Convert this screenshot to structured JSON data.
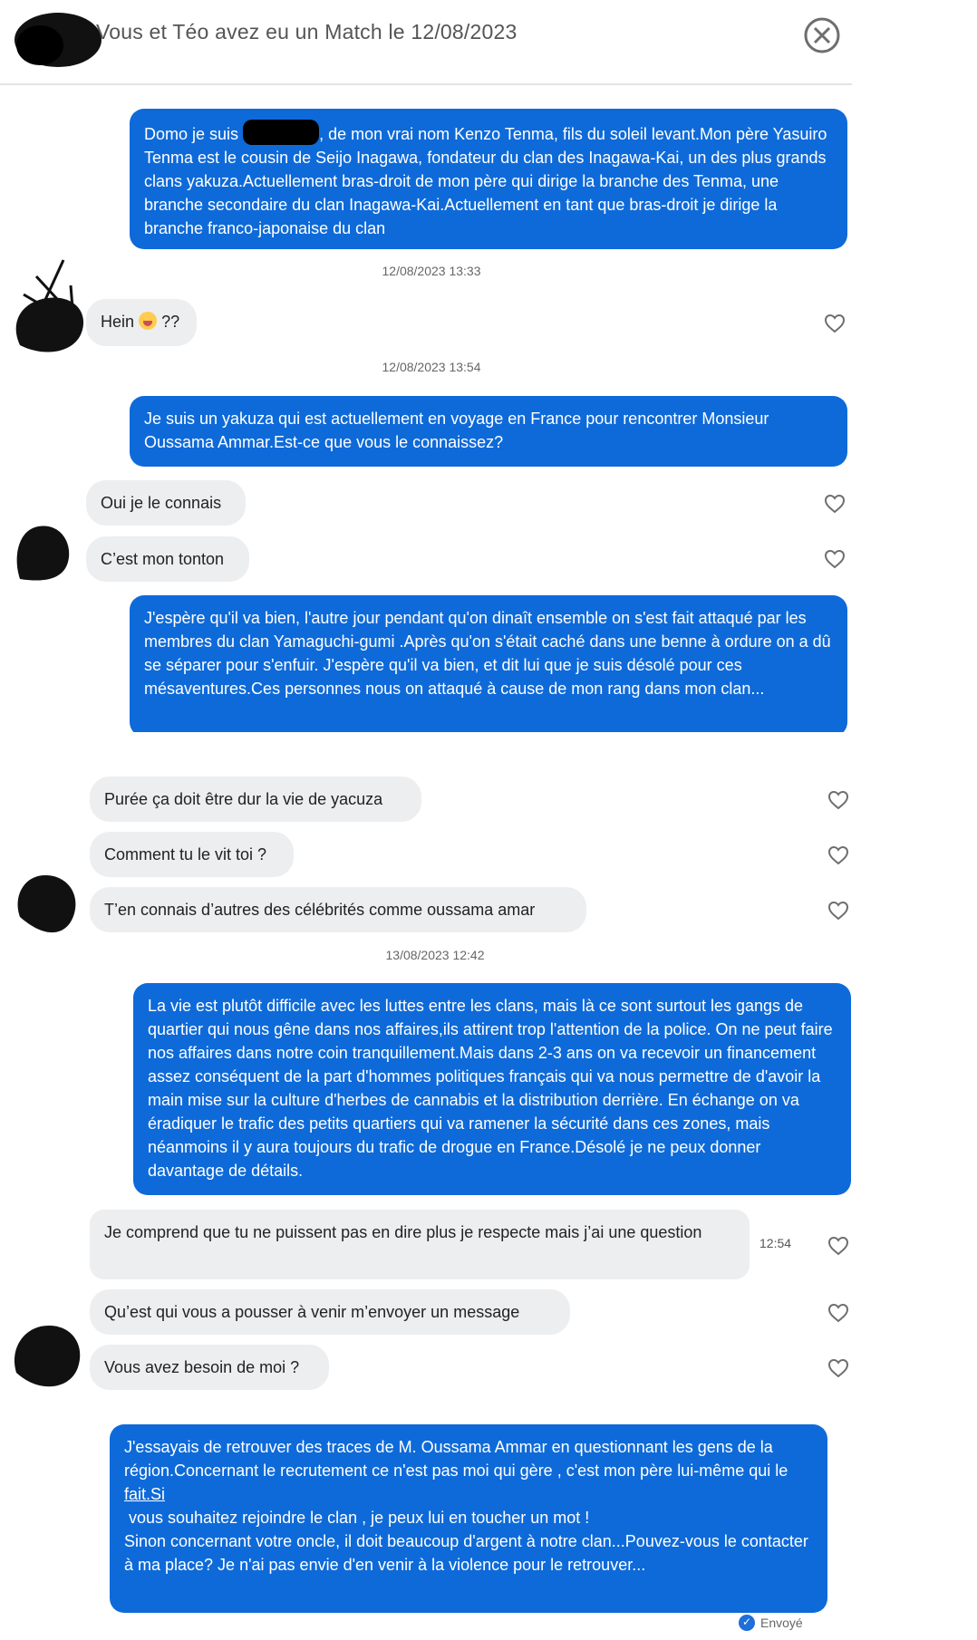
{
  "header": {
    "title": "Vous et Téo avez eu un Match le 12/08/2023",
    "close_icon": "close-circle-icon"
  },
  "messages": [
    {
      "type": "sent",
      "text_pre": "Domo je suis",
      "text_post": ", de mon vrai nom Kenzo Tenma, fils du soleil levant.Mon père Yasuiro Tenma est le cousin de Seijo Inagawa, fondateur du clan des Inagawa-Kai, un des plus grands clans yakuza.Actuellement bras-droit de mon père qui dirige la branche des Tenma, une branche secondaire du clan Inagawa-Kai.Actuellement en tant que bras-droit je dirige la branche franco-japonaise du clan"
    },
    {
      "type": "timestamp",
      "text": "12/08/2023 13:33"
    },
    {
      "type": "recv",
      "text_pre": "Hein",
      "text_post": "??"
    },
    {
      "type": "timestamp",
      "text": "12/08/2023 13:54"
    },
    {
      "type": "sent",
      "text": "Je suis un yakuza qui est actuellement en voyage en France pour rencontrer Monsieur Oussama Ammar.Est-ce que vous le connaissez?"
    },
    {
      "type": "recv",
      "text": "Oui je le connais"
    },
    {
      "type": "recv",
      "text": "C’est mon tonton"
    },
    {
      "type": "sent",
      "text": "J'espère qu'il va bien, l'autre jour pendant qu'on dinaît ensemble on s'est fait attaqué par les membres du clan Yamaguchi-gumi .Après qu'on s'était caché dans une benne à ordure on a dû se séparer pour s'enfuir. J'espère qu'il va bien, et dit lui que je suis désolé pour ces mésaventures.Ces personnes nous on attaqué à cause de mon rang dans mon clan..."
    },
    {
      "type": "recv",
      "text": "Purée ça doit être dur la vie de yacuza"
    },
    {
      "type": "recv",
      "text": "Comment tu le vit toi ?"
    },
    {
      "type": "recv",
      "text": "T’en connais d’autres des célébrités comme oussama amar"
    },
    {
      "type": "timestamp",
      "text": "13/08/2023 12:42"
    },
    {
      "type": "sent",
      "text": "La vie est plutôt difficile avec les luttes entre les clans, mais là ce sont surtout les gangs de quartier qui nous gêne dans nos affaires,ils attirent trop l'attention de la police. On ne peut faire nos affaires dans notre coin tranquillement.Mais dans 2-3 ans on va recevoir un financement assez conséquent de la part d'hommes politiques français qui va nous permettre de d'avoir la main mise sur la culture d'herbes de cannabis  et la distribution derrière. En échange on va éradiquer le trafic des petits quartiers qui va ramener la sécurité dans ces zones, mais néanmoins il y aura toujours du trafic de drogue en France.Désolé je ne peux donner davantage de détails."
    },
    {
      "type": "recv",
      "text": "Je comprend que tu ne puissent pas en dire plus je respecte mais j’ai une question",
      "time": "12:54"
    },
    {
      "type": "recv",
      "text": "Qu’est qui vous a pousser à venir m’envoyer un message"
    },
    {
      "type": "recv",
      "text": "Vous avez besoin de moi ?"
    },
    {
      "type": "sent",
      "text_a": "J'essayais de retrouver des traces de M. Oussama Ammar en questionnant les gens de la région.Concernant le recrutement ce n'est pas moi qui gère , c'est mon père lui-même qui le",
      "link": "fait.Si",
      "text_b": " vous souhaitez rejoindre le clan , je peux lui en toucher un mot !",
      "text_c": "Sinon concernant votre oncle, il doit beaucoup d'argent à notre clan...Pouvez-vous le contacter à ma place? Je n'ai pas envie d'en venir à la violence pour le retrouver..."
    }
  ],
  "status": {
    "text": "Envoyé",
    "icon": "sent-check-icon"
  },
  "icons": {
    "like": "heart-icon",
    "emoji": "crying-face-emoji"
  },
  "colors": {
    "sent_bubble": "#0e6ad9",
    "recv_bubble": "#eceef0"
  }
}
